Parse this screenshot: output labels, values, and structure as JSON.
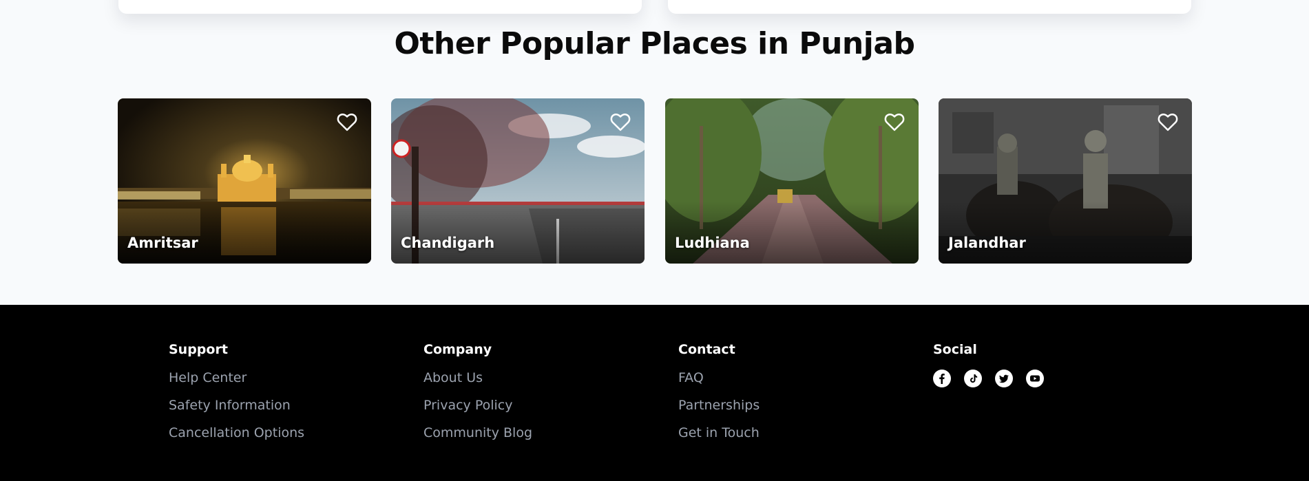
{
  "section": {
    "title": "Other Popular Places in Punjab"
  },
  "places": [
    {
      "name": "Amritsar"
    },
    {
      "name": "Chandigarh"
    },
    {
      "name": "Ludhiana"
    },
    {
      "name": "Jalandhar"
    }
  ],
  "footer": {
    "support": {
      "heading": "Support",
      "links": [
        "Help Center",
        "Safety Information",
        "Cancellation Options"
      ]
    },
    "company": {
      "heading": "Company",
      "links": [
        "About Us",
        "Privacy Policy",
        "Community Blog"
      ]
    },
    "contact": {
      "heading": "Contact",
      "links": [
        "FAQ",
        "Partnerships",
        "Get in Touch"
      ]
    },
    "social": {
      "heading": "Social",
      "icons": [
        "facebook-icon",
        "tiktok-icon",
        "twitter-icon",
        "youtube-icon"
      ]
    }
  }
}
